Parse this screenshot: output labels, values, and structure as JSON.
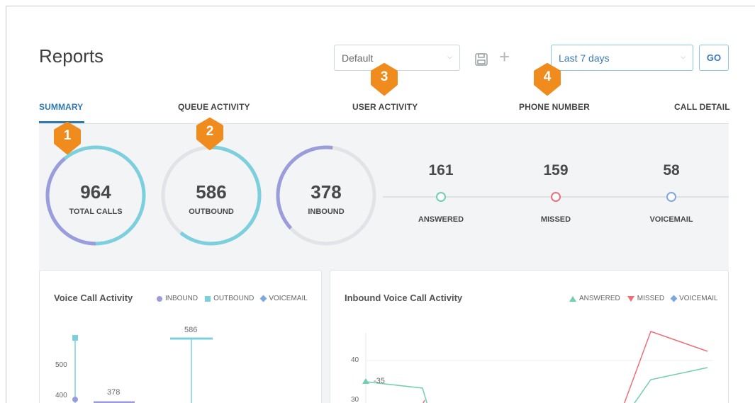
{
  "header": {
    "title": "Reports"
  },
  "toolbar": {
    "view_select": "Default",
    "range_select": "Last 7 days",
    "go_label": "GO",
    "save_icon": "save-icon",
    "add_icon": "plus-icon"
  },
  "tabs": [
    {
      "label": "SUMMARY",
      "active": true
    },
    {
      "label": "QUEUE ACTIVITY",
      "active": false
    },
    {
      "label": "USER ACTIVITY",
      "active": false
    },
    {
      "label": "PHONE NUMBER",
      "active": false
    },
    {
      "label": "CALL DETAIL",
      "active": false
    }
  ],
  "summary": {
    "rings": [
      {
        "value": "964",
        "label": "TOTAL CALLS"
      },
      {
        "value": "586",
        "label": "OUTBOUND"
      },
      {
        "value": "378",
        "label": "INBOUND"
      }
    ],
    "stats": [
      {
        "value": "161",
        "label": "ANSWERED",
        "color": "#6fcfb0"
      },
      {
        "value": "159",
        "label": "MISSED",
        "color": "#ee6f7a"
      },
      {
        "value": "58",
        "label": "VOICEMAIL",
        "color": "#7fa7e0"
      }
    ]
  },
  "colors": {
    "accent": "#2e7ab0",
    "inbound": "#9b9cdc",
    "outbound": "#7ccfdc",
    "voicemail": "#7fa7e0",
    "answered": "#6fcfb0",
    "missed": "#ee6f7a",
    "badge": "#f08c1e"
  },
  "callouts": [
    "1",
    "2",
    "3",
    "4"
  ],
  "voice_chart": {
    "title": "Voice Call Activity",
    "legend": [
      "INBOUND",
      "OUTBOUND",
      "VOICEMAIL"
    ],
    "y_ticks": [
      "500",
      "400"
    ],
    "data_labels": [
      "586",
      "378"
    ]
  },
  "inbound_chart": {
    "title": "Inbound Voice Call Activity",
    "legend": [
      "ANSWERED",
      "MISSED",
      "VOICEMAIL"
    ],
    "y_ticks": [
      "40",
      "30"
    ],
    "data_label": "35"
  }
}
